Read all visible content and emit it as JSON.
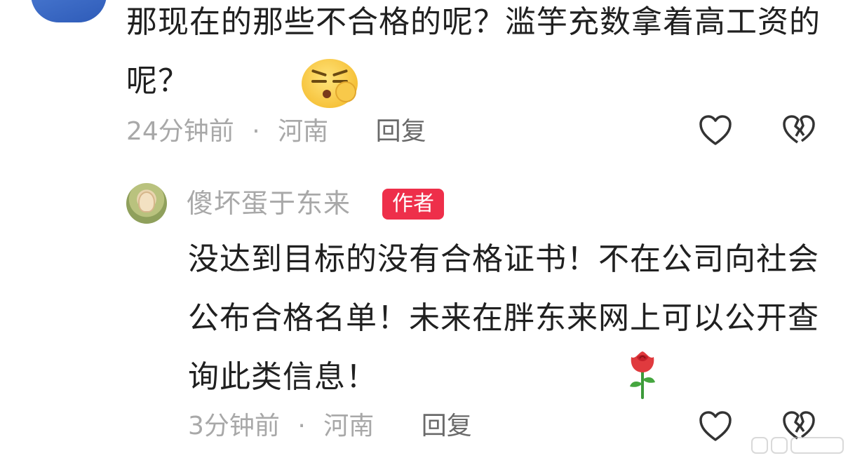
{
  "top_comment": {
    "text": "那现在的那些不合格的呢？滥竽充数拿着高工资的呢？",
    "time": "24分钟前",
    "separator": "·",
    "location": "河南",
    "reply_label": "回复",
    "emoji": "smirking-thinking-face-emoji"
  },
  "reply_comment": {
    "username": "傻坏蛋于东来",
    "badge": "作者",
    "text": "没达到目标的没有合格证书！不在公司向社会公布合格名单！未来在胖东来网上可以公开查询此类信息！",
    "time": "3分钟前",
    "separator": "·",
    "location": "河南",
    "reply_label": "回复",
    "emoji": "rose-emoji"
  },
  "colors": {
    "badge_bg": "#ee2f4a",
    "meta_gray": "#a8a8a8",
    "text_dark": "#202020"
  }
}
